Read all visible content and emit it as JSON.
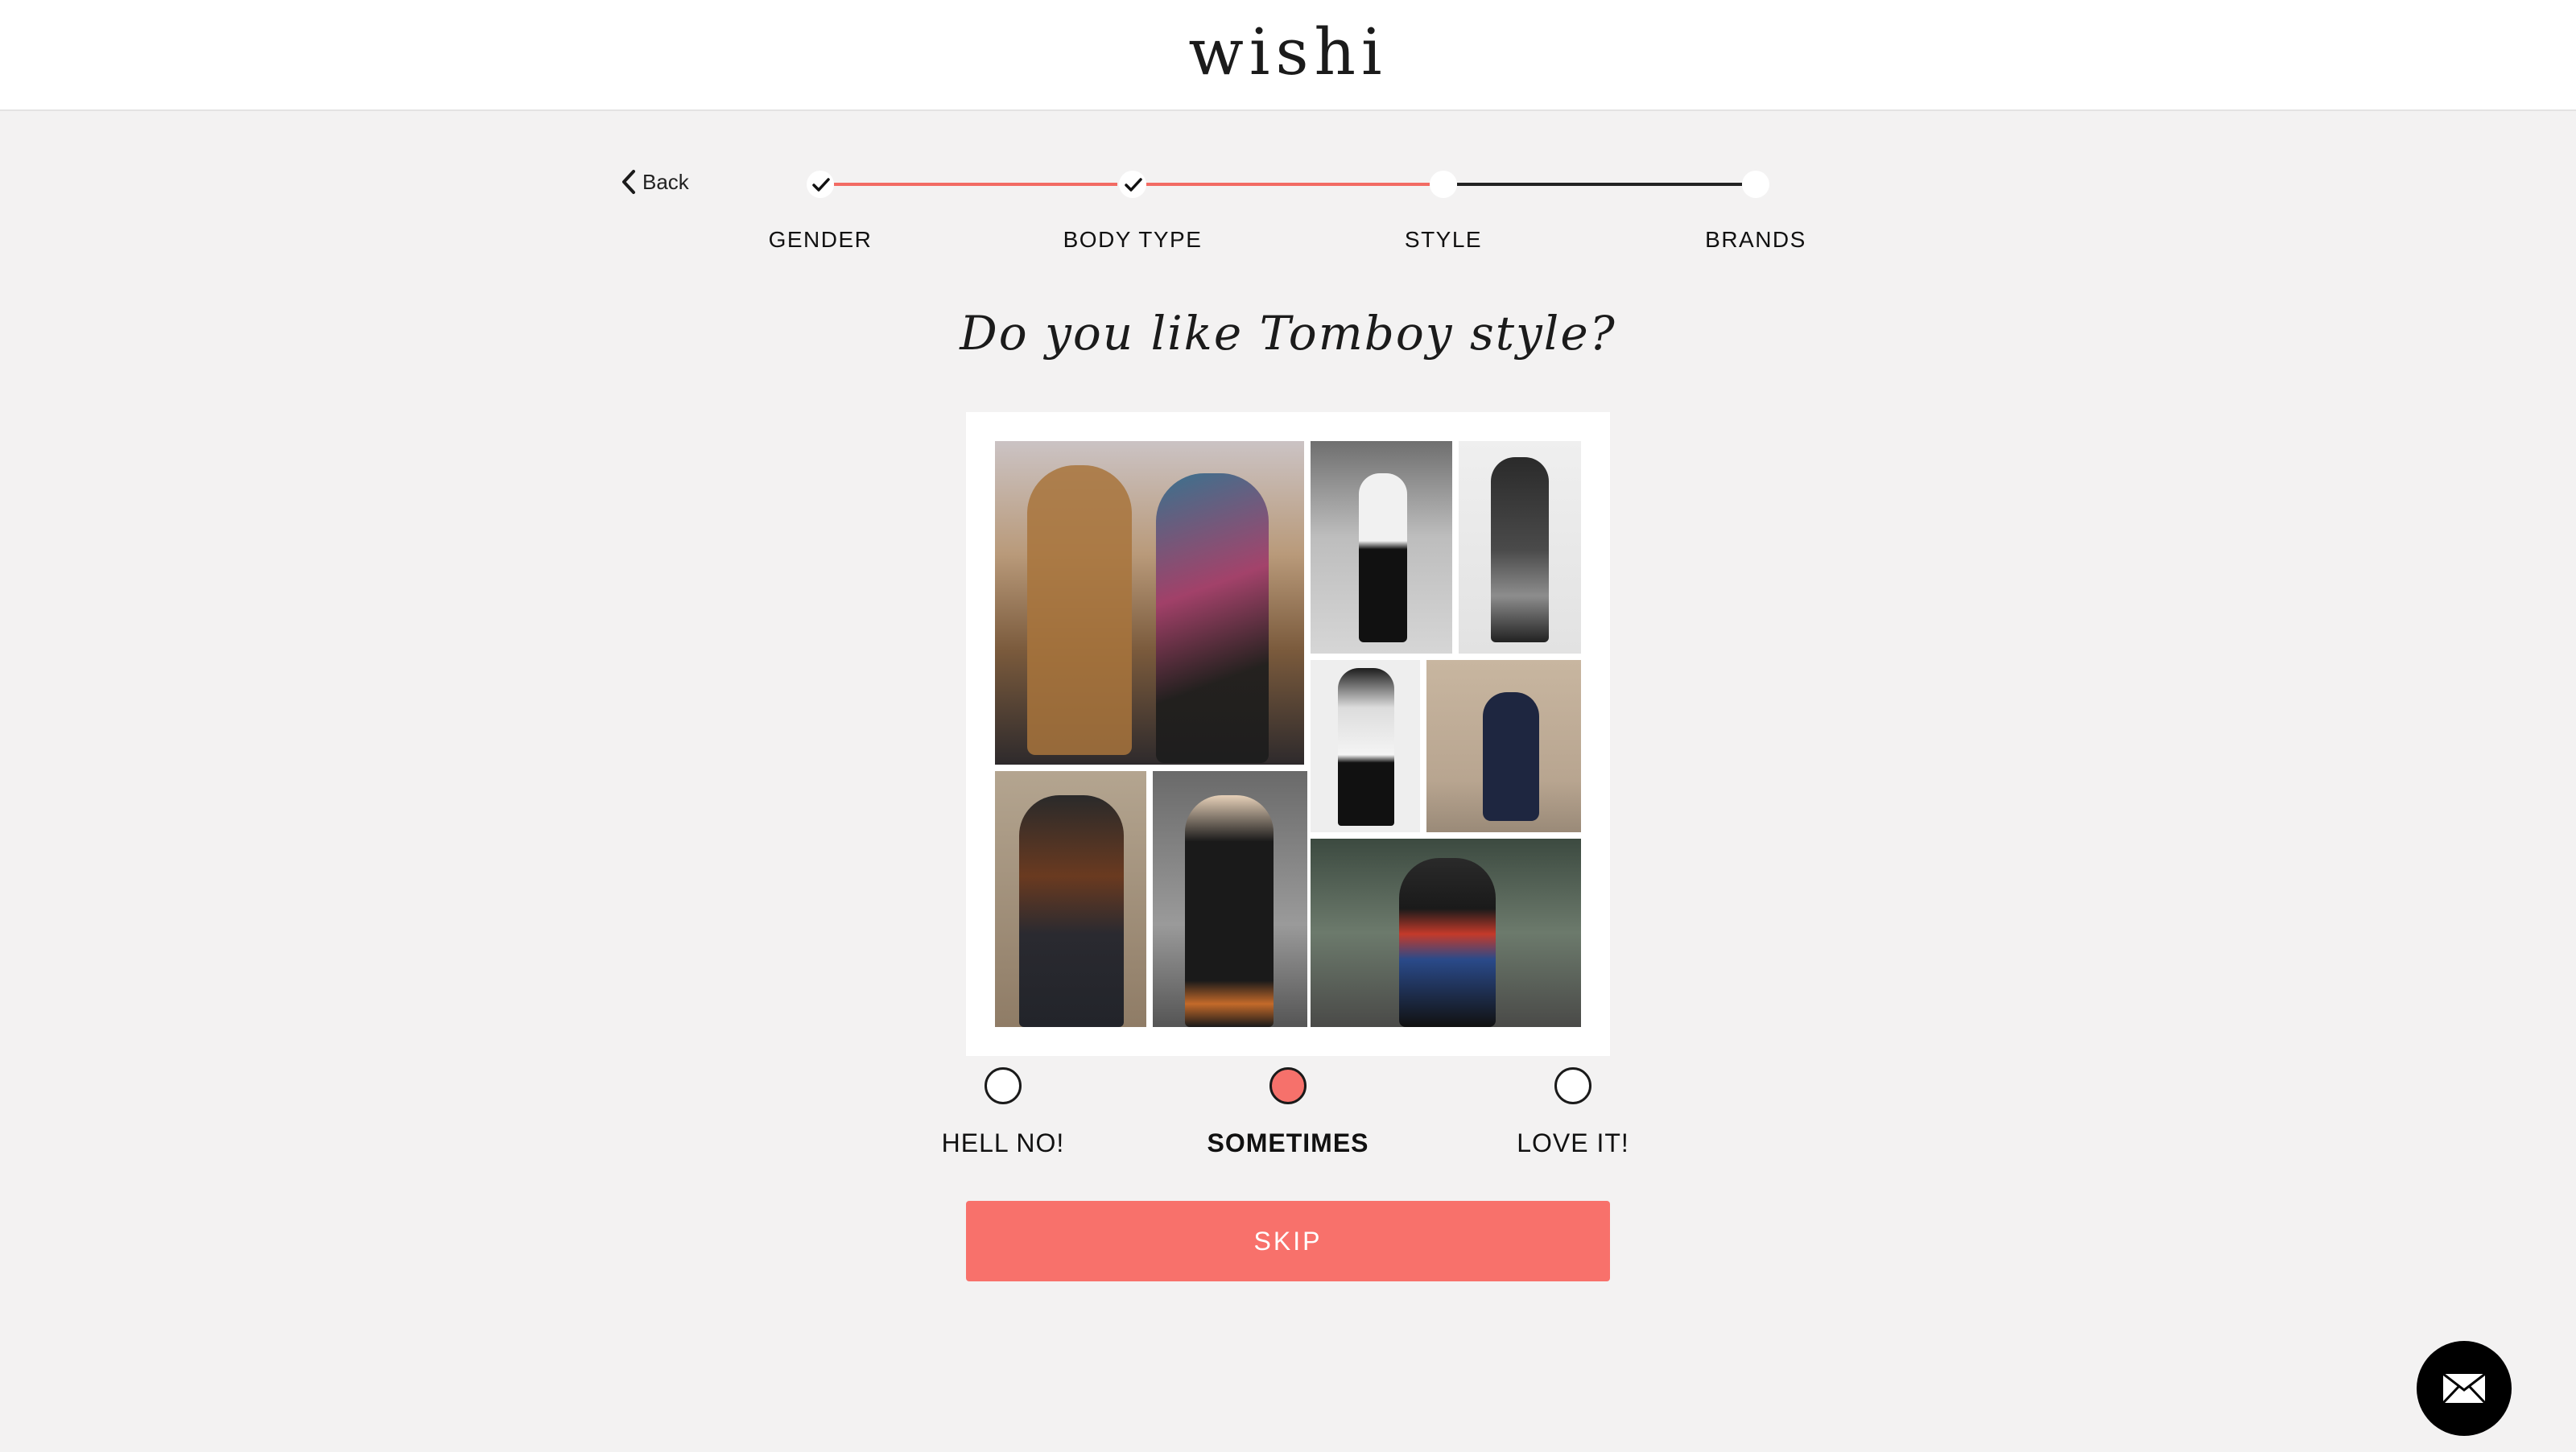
{
  "header": {
    "logo": "wishi"
  },
  "nav": {
    "back_label": "Back",
    "back_icon": "chevron-left-icon"
  },
  "stepper": {
    "steps": [
      {
        "label": "GENDER",
        "status": "complete"
      },
      {
        "label": "BODY TYPE",
        "status": "complete"
      },
      {
        "label": "STYLE",
        "status": "current"
      },
      {
        "label": "BRANDS",
        "status": "pending"
      }
    ],
    "colors": {
      "complete": "#f26b63",
      "pending": "#222222"
    }
  },
  "question": {
    "text": "Do you like Tomboy style?"
  },
  "answers": {
    "options": [
      {
        "label": "HELL NO!",
        "selected": false
      },
      {
        "label": "SOMETIMES",
        "selected": true
      },
      {
        "label": "LOVE IT!",
        "selected": false
      }
    ],
    "selected_color": "#f6716b"
  },
  "skip": {
    "label": "SKIP",
    "color": "#f8716b"
  },
  "chat": {
    "icon": "envelope-icon"
  }
}
